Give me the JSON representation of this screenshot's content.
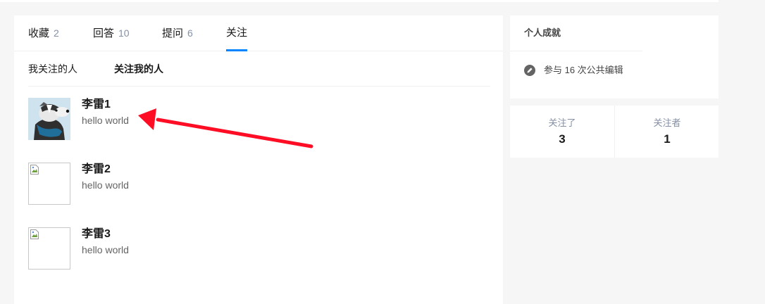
{
  "tabs": [
    {
      "label": "收藏",
      "count": "2"
    },
    {
      "label": "回答",
      "count": "10"
    },
    {
      "label": "提问",
      "count": "6"
    },
    {
      "label": "关注",
      "count": ""
    }
  ],
  "subtabs": [
    {
      "label": "我关注的人"
    },
    {
      "label": "关注我的人"
    }
  ],
  "users": [
    {
      "name": "李雷1",
      "bio": "hello world",
      "avatar": "badger-avatar"
    },
    {
      "name": "李雷2",
      "bio": "hello world",
      "avatar": "broken-image"
    },
    {
      "name": "李雷3",
      "bio": "hello world",
      "avatar": "broken-image"
    }
  ],
  "sidebar": {
    "achievements_title": "个人成就",
    "edit_text": "参与 16 次公共编辑",
    "stats": [
      {
        "label": "关注了",
        "value": "3"
      },
      {
        "label": "关注者",
        "value": "1"
      }
    ]
  },
  "colors": {
    "accent": "#0084ff",
    "arrow": "#ff0d24"
  }
}
